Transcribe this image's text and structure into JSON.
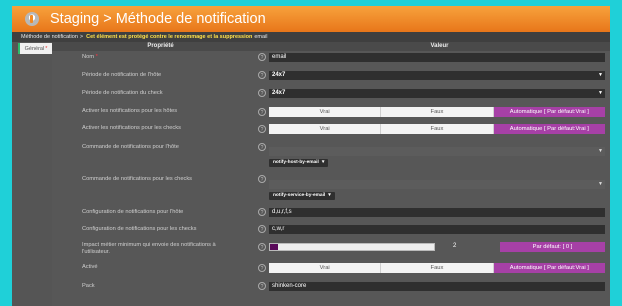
{
  "window": {
    "title": "Staging > Méthode de notification"
  },
  "breadcrumb": {
    "section": "Méthode de notification",
    "separator": ">",
    "warning": "Cet élément est protégé contre le renommage et la suppression",
    "item": "email"
  },
  "tabs": [
    {
      "label": "Général",
      "required_mark": "*"
    }
  ],
  "table": {
    "col_property": "Propriété",
    "col_value": "Valeur"
  },
  "fields": {
    "name": {
      "label": "Nom",
      "required_mark": "*",
      "value": "email"
    },
    "host_period": {
      "label": "Période de notification de l'hôte",
      "value": "24x7"
    },
    "check_period": {
      "label": "Période de notification du check",
      "value": "24x7"
    },
    "host_enable": {
      "label": "Activer les notifications pour les hôtes",
      "options": [
        "Vrai",
        "Faux",
        "Automatique [ Par défaut:Vrai ]"
      ],
      "selected": 2
    },
    "check_enable": {
      "label": "Activer les notifications pour les checks",
      "options": [
        "Vrai",
        "Faux",
        "Automatique [ Par défaut:Vrai ]"
      ],
      "selected": 2
    },
    "host_cmd": {
      "label": "Commande de notifications pour l'hôte",
      "tag": "notify-host-by-email"
    },
    "check_cmd": {
      "label": "Commande de notifications pour les checks",
      "tag": "notify-service-by-email"
    },
    "host_conf": {
      "label": "Configuration de notifications pour l'hôte",
      "value": "d,u,r,f,s"
    },
    "check_conf": {
      "label": "Configuration de notifications pour les checks",
      "value": "c,w,r"
    },
    "impact": {
      "label": "Impact métier minimum qui envoie des notifications à l'utilisateur.",
      "value": "2",
      "level_fraction": 0.05,
      "default_label": "Par défaut: [ 0 ]"
    },
    "active": {
      "label": "Activé",
      "options": [
        "Vrai",
        "Faux",
        "Automatique [ Par défaut:Vrai ]"
      ],
      "selected": 2
    },
    "pack": {
      "label": "Pack",
      "value": "shinken-core"
    }
  },
  "icons": {
    "help": "?",
    "caret": "▼",
    "remove": "▾"
  },
  "colors": {
    "title_orange": "#f08a24",
    "accent_purple": "#a640a6",
    "warning_yellow": "#ffe14a"
  }
}
